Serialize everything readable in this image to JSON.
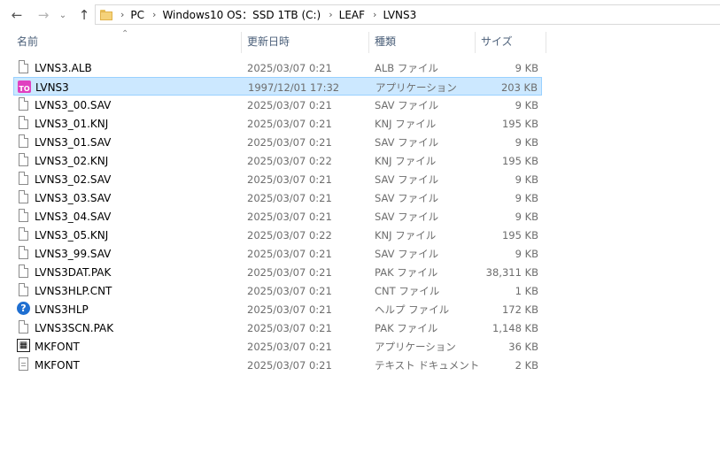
{
  "breadcrumbs": [
    "PC",
    "Windows10 OS：SSD 1TB (C:)",
    "LEAF",
    "LVNS3"
  ],
  "columns": {
    "name": "名前",
    "date": "更新日時",
    "type": "種類",
    "size": "サイズ"
  },
  "files": [
    {
      "name": "LVNS3.ALB",
      "date": "2025/03/07 0:21",
      "type": "ALB ファイル",
      "size": "9 KB",
      "icon": "file-icon"
    },
    {
      "name": "LVNS3",
      "date": "1997/12/01 17:32",
      "type": "アプリケーション",
      "size": "203 KB",
      "icon": "app-icon"
    },
    {
      "name": "LVNS3_00.SAV",
      "date": "2025/03/07 0:21",
      "type": "SAV ファイル",
      "size": "9 KB",
      "icon": "file-icon"
    },
    {
      "name": "LVNS3_01.KNJ",
      "date": "2025/03/07 0:21",
      "type": "KNJ ファイル",
      "size": "195 KB",
      "icon": "file-icon"
    },
    {
      "name": "LVNS3_01.SAV",
      "date": "2025/03/07 0:21",
      "type": "SAV ファイル",
      "size": "9 KB",
      "icon": "file-icon"
    },
    {
      "name": "LVNS3_02.KNJ",
      "date": "2025/03/07 0:22",
      "type": "KNJ ファイル",
      "size": "195 KB",
      "icon": "file-icon"
    },
    {
      "name": "LVNS3_02.SAV",
      "date": "2025/03/07 0:21",
      "type": "SAV ファイル",
      "size": "9 KB",
      "icon": "file-icon"
    },
    {
      "name": "LVNS3_03.SAV",
      "date": "2025/03/07 0:21",
      "type": "SAV ファイル",
      "size": "9 KB",
      "icon": "file-icon"
    },
    {
      "name": "LVNS3_04.SAV",
      "date": "2025/03/07 0:21",
      "type": "SAV ファイル",
      "size": "9 KB",
      "icon": "file-icon"
    },
    {
      "name": "LVNS3_05.KNJ",
      "date": "2025/03/07 0:22",
      "type": "KNJ ファイル",
      "size": "195 KB",
      "icon": "file-icon"
    },
    {
      "name": "LVNS3_99.SAV",
      "date": "2025/03/07 0:21",
      "type": "SAV ファイル",
      "size": "9 KB",
      "icon": "file-icon"
    },
    {
      "name": "LVNS3DAT.PAK",
      "date": "2025/03/07 0:21",
      "type": "PAK ファイル",
      "size": "38,311 KB",
      "icon": "file-icon"
    },
    {
      "name": "LVNS3HLP.CNT",
      "date": "2025/03/07 0:21",
      "type": "CNT ファイル",
      "size": "1 KB",
      "icon": "file-icon"
    },
    {
      "name": "LVNS3HLP",
      "date": "2025/03/07 0:21",
      "type": "ヘルプ ファイル",
      "size": "172 KB",
      "icon": "help-icon"
    },
    {
      "name": "LVNS3SCN.PAK",
      "date": "2025/03/07 0:21",
      "type": "PAK ファイル",
      "size": "1,148 KB",
      "icon": "file-icon"
    },
    {
      "name": "MKFONT",
      "date": "2025/03/07 0:21",
      "type": "アプリケーション",
      "size": "36 KB",
      "icon": "mkfont-app-icon"
    },
    {
      "name": "MKFONT",
      "date": "2025/03/07 0:21",
      "type": "テキスト ドキュメント",
      "size": "2 KB",
      "icon": "text-file-icon"
    }
  ],
  "selected_index": 1,
  "colors": {
    "selected_bg": "#cce8ff",
    "selected_border": "#99d1ff",
    "header_text": "#4c607a"
  }
}
